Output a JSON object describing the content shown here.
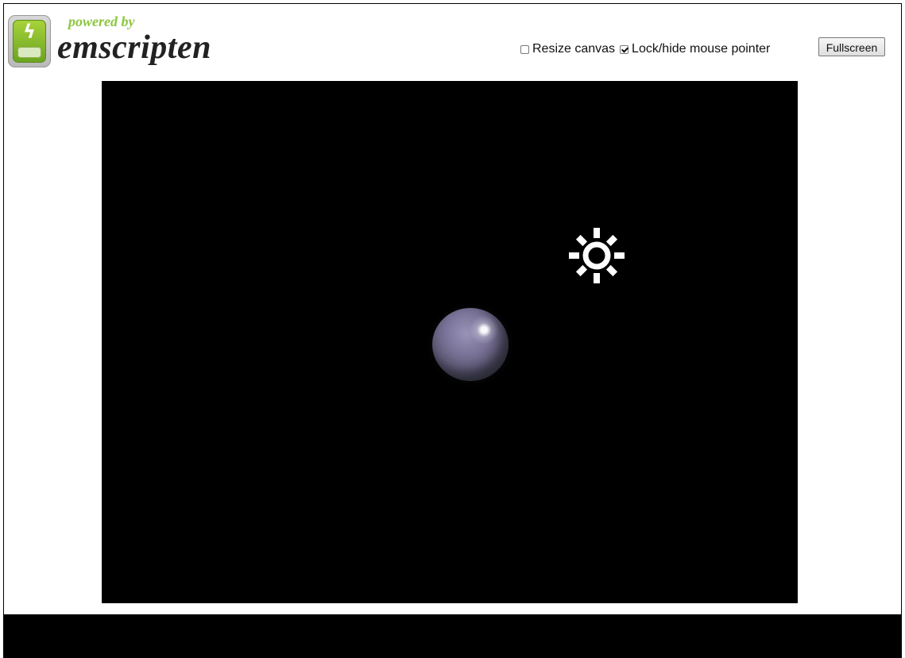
{
  "header": {
    "logo": {
      "powered_by": "powered by",
      "brand": "emscripten",
      "icon": "battery-bolt-icon"
    },
    "controls": {
      "resize_canvas": {
        "label": "Resize canvas",
        "checked": false
      },
      "lock_pointer": {
        "label": "Lock/hide mouse pointer",
        "checked": true
      },
      "fullscreen_label": "Fullscreen"
    }
  },
  "canvas": {
    "background": "#000000",
    "sun_icon": "sun-icon",
    "sphere_color": "#7a7398"
  },
  "colors": {
    "brand_green": "#8cc63e",
    "page_background": "#ffffff",
    "canvas_background": "#000000"
  }
}
